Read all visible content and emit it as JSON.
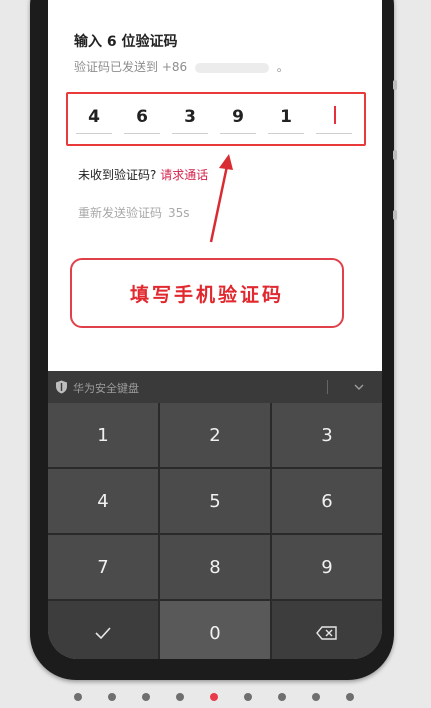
{
  "verify": {
    "title": "输入 6 位验证码",
    "sent_prefix": "验证码已发送到 +86",
    "sent_suffix": "。",
    "digits": [
      "4",
      "6",
      "3",
      "9",
      "1",
      ""
    ],
    "not_received": "未收到验证码?",
    "call_link": "请求通话",
    "resend_label": "重新发送验证码",
    "resend_countdown": "35s"
  },
  "callout": {
    "text": "填写手机验证码"
  },
  "keyboard": {
    "title": "华为安全键盘",
    "keys": [
      "1",
      "2",
      "3",
      "4",
      "5",
      "6",
      "7",
      "8",
      "9",
      "",
      "0",
      ""
    ],
    "confirm_icon": "check-icon",
    "delete_icon": "backspace-icon"
  },
  "pager": {
    "count": 9,
    "active_index": 4
  },
  "colors": {
    "accent": "#d6204a",
    "annotation_red": "#e83a3a",
    "keyboard_bg": "#4b4b4b"
  }
}
